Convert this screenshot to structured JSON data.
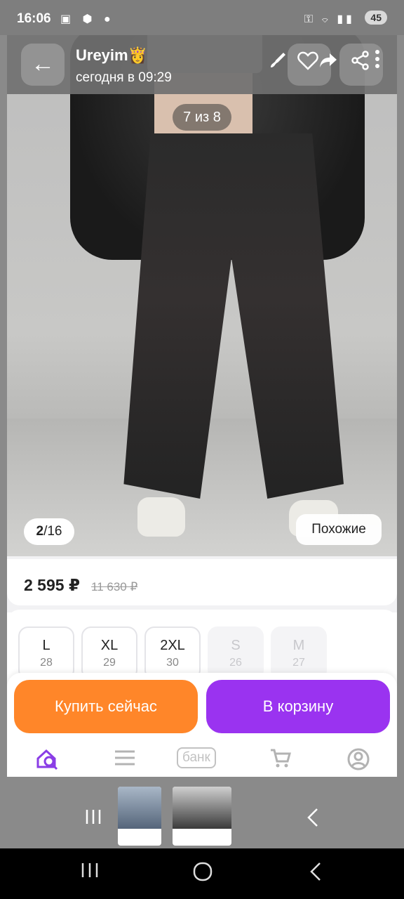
{
  "status": {
    "time": "16:06",
    "left_icons": "▣ ⬢ ●",
    "right_icons": "⚿ ⌔ ▮▮",
    "battery": "45"
  },
  "header": {
    "back_glyph": "←",
    "seller_name": "Ureyim👸",
    "seller_time": "сегодня в 09:29"
  },
  "photo": {
    "counter": "7 из 8",
    "page_current": "2",
    "page_total": "/16",
    "similar_label": "Похожие"
  },
  "price": {
    "current": "2 595 ₽",
    "old": "11 630 ₽"
  },
  "sizes": [
    {
      "label": "L",
      "num": "28",
      "available": true
    },
    {
      "label": "XL",
      "num": "29",
      "available": true
    },
    {
      "label": "2XL",
      "num": "30",
      "available": true
    },
    {
      "label": "S",
      "num": "26",
      "available": false
    },
    {
      "label": "M",
      "num": "27",
      "available": false
    }
  ],
  "buttons": {
    "buy_now": "Купить сейчас",
    "add_to_cart": "В корзину"
  },
  "bottom_nav": {
    "bank_label": "банк"
  },
  "colors": {
    "buy_button": "#ff8629",
    "cart_button": "#9a33f0",
    "active_nav": "#8a3de6"
  }
}
